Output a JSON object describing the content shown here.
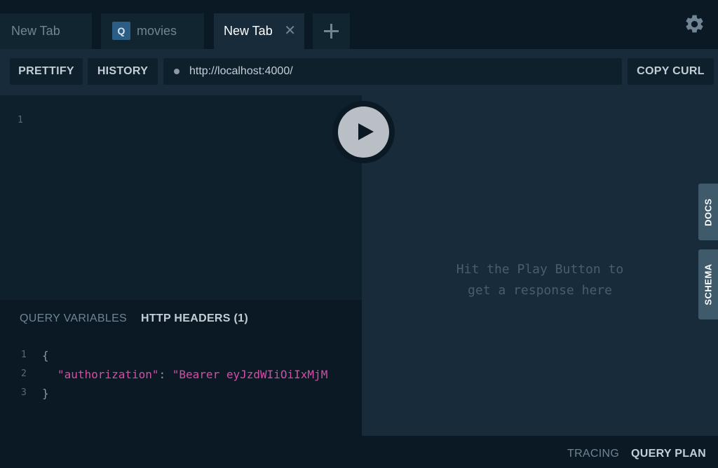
{
  "tabs": [
    {
      "label": "New Tab"
    },
    {
      "badge": "Q",
      "label": "movies"
    },
    {
      "label": "New Tab",
      "close": "✕"
    }
  ],
  "toolbar": {
    "prettify_label": "PRETTIFY",
    "history_label": "HISTORY",
    "url": "http://localhost:4000/",
    "copy_curl_label": "COPY CURL"
  },
  "editor": {
    "line_numbers": [
      "1"
    ]
  },
  "response": {
    "line1": "Hit the Play Button to",
    "line2": "get a response here"
  },
  "side_tabs": {
    "docs": "DOCS",
    "schema": "SCHEMA"
  },
  "variables": {
    "query_variables_tab": "QUERY VARIABLES",
    "http_headers_tab": "HTTP HEADERS (1)",
    "line_numbers": [
      "1",
      "2",
      "3"
    ],
    "open_brace": "{",
    "header_key": "\"authorization\"",
    "colon": ": ",
    "header_value": "\"Bearer eyJzdWIiOiIxMjM",
    "close_brace": "}"
  },
  "footer": {
    "tracing": "TRACING",
    "query_plan": "QUERY PLAN"
  },
  "icons": {
    "settings": "gear-icon",
    "add_tab": "plus-icon",
    "play": "play-icon",
    "close_tab": "close-icon"
  },
  "colors": {
    "accent_string": "#d44ea6",
    "badge": "#2b5d85"
  }
}
